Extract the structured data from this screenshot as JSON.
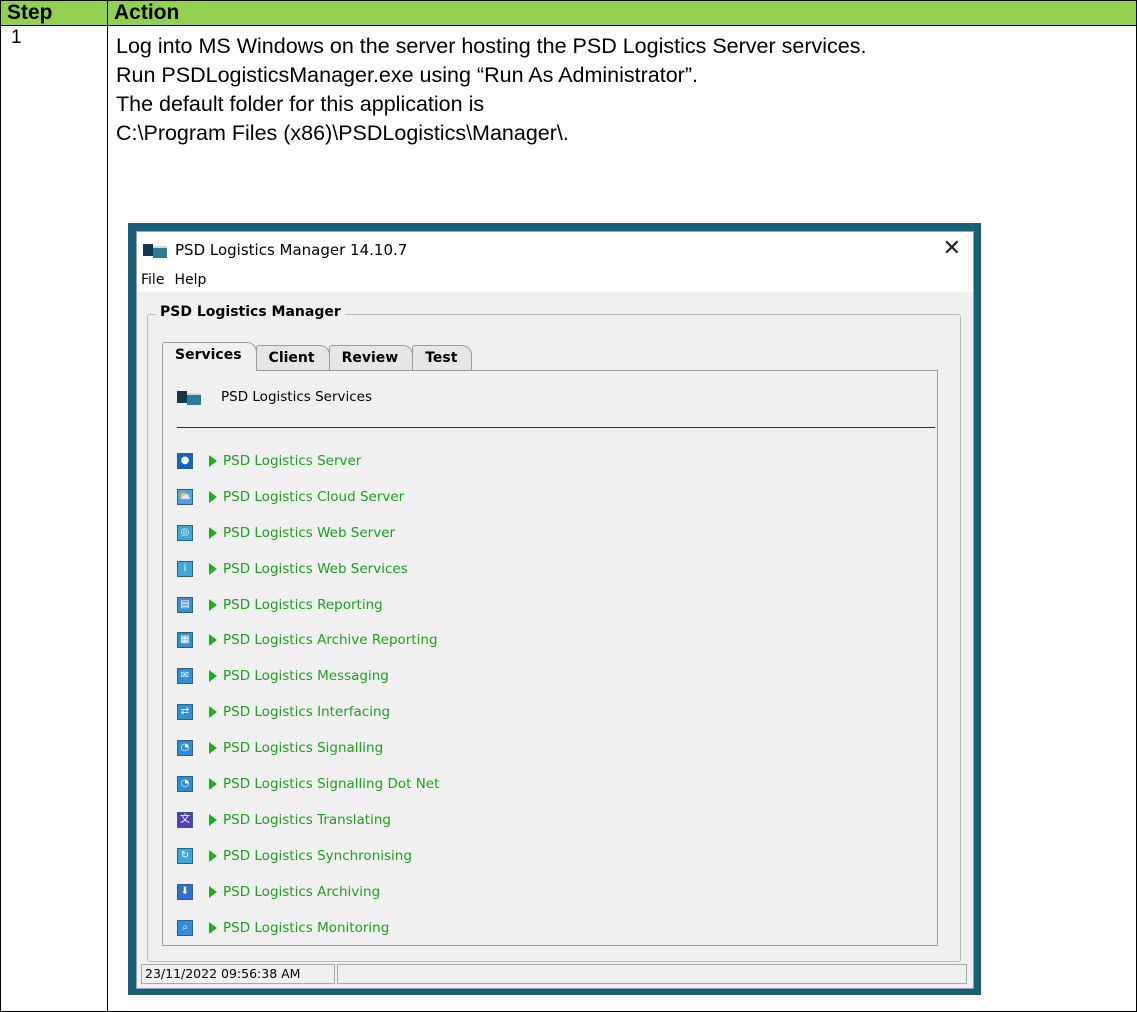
{
  "table": {
    "headers": {
      "step": "Step",
      "action": "Action"
    },
    "row": {
      "step": "1",
      "lines": [
        "Log into MS Windows on the server hosting the PSD Logistics Server services.",
        "Run PSDLogisticsManager.exe using “Run As Administrator”.",
        "The default folder for this application is",
        "C:\\Program Files (x86)\\PSDLogistics\\Manager\\."
      ]
    }
  },
  "window": {
    "title": "PSD Logistics Manager 14.10.7",
    "close_glyph": "✕",
    "menu": [
      "File",
      "Help"
    ],
    "group_label": "PSD Logistics Manager",
    "tabs": [
      {
        "label": "Services",
        "active": true
      },
      {
        "label": "Client",
        "active": false
      },
      {
        "label": "Review",
        "active": false
      },
      {
        "label": "Test",
        "active": false
      }
    ],
    "panel_title": "PSD Logistics Services",
    "services": [
      {
        "label": "PSD Logistics Server",
        "icon": "globe-icon",
        "color": "#1565c0",
        "glyph": "●"
      },
      {
        "label": "PSD Logistics Cloud Server",
        "icon": "cloud-server-icon",
        "color": "#4fa3e0",
        "glyph": "⛅"
      },
      {
        "label": "PSD Logistics Web Server",
        "icon": "web-server-icon",
        "color": "#3fa7d6",
        "glyph": "◎"
      },
      {
        "label": "PSD Logistics Web Services",
        "icon": "web-services-icon",
        "color": "#42a5d5",
        "glyph": "i"
      },
      {
        "label": "PSD Logistics Reporting",
        "icon": "report-icon",
        "color": "#3b8fc9",
        "glyph": "▤"
      },
      {
        "label": "PSD Logistics Archive Reporting",
        "icon": "archive-report-icon",
        "color": "#3b8fc9",
        "glyph": "▦"
      },
      {
        "label": "PSD Logistics Messaging",
        "icon": "message-icon",
        "color": "#2f8fd8",
        "glyph": "✉"
      },
      {
        "label": "PSD Logistics Interfacing",
        "icon": "interface-icon",
        "color": "#2f8fd8",
        "glyph": "⇄"
      },
      {
        "label": "PSD Logistics Signalling",
        "icon": "signal-icon",
        "color": "#2a8fcf",
        "glyph": "◔"
      },
      {
        "label": "PSD Logistics Signalling Dot Net",
        "icon": "signal-dotnet-icon",
        "color": "#2a8fcf",
        "glyph": "◔"
      },
      {
        "label": "PSD Logistics Translating",
        "icon": "translate-icon",
        "color": "#5040b0",
        "glyph": "文"
      },
      {
        "label": "PSD Logistics Synchronising",
        "icon": "sync-icon",
        "color": "#3fa7d6",
        "glyph": "↻"
      },
      {
        "label": "PSD Logistics Archiving",
        "icon": "archive-icon",
        "color": "#2f6fd0",
        "glyph": "⬇"
      },
      {
        "label": "PSD Logistics Monitoring",
        "icon": "monitor-icon",
        "color": "#2f8fd8",
        "glyph": "⌕"
      }
    ],
    "status": {
      "datetime": "23/11/2022 09:56:38 AM",
      "message": ""
    },
    "colors": {
      "service_text": "#1f9e1f",
      "header_green": "#92d050",
      "frame_teal": "#1b5e77"
    }
  }
}
